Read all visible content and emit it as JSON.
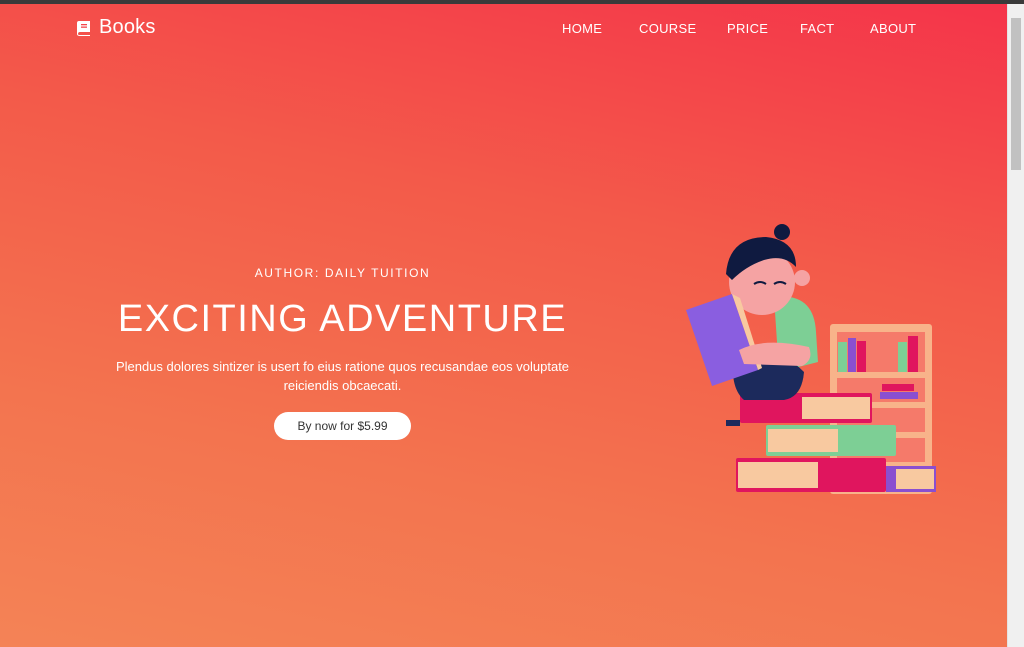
{
  "header": {
    "brand": {
      "icon": "book-icon",
      "name": "Books"
    },
    "nav": [
      {
        "label": "HOME"
      },
      {
        "label": "COURSE"
      },
      {
        "label": "PRICE"
      },
      {
        "label": "FACT"
      },
      {
        "label": "ABOUT"
      }
    ]
  },
  "hero": {
    "author": "AUTHOR: DAILY TUITION",
    "title": "EXCITING ADVENTURE",
    "description": "Plendus dolores sintizer is usert fo eius ratione quos recusandae eos voluptate reiciendis obcaecati.",
    "button": "By now for $5.99",
    "illustration": "boy-reading-on-books-illustration"
  },
  "colors": {
    "gradient_top": "#f5344a",
    "gradient_bottom": "#f48356",
    "button_bg": "#ffffff"
  }
}
